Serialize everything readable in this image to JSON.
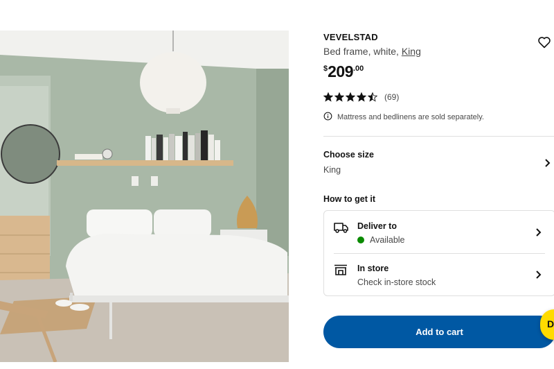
{
  "product": {
    "name": "VEVELSTAD",
    "description": "Bed frame, white, ",
    "size_link": "King",
    "price": {
      "currency": "$",
      "integer": "209",
      "decimal": ".00"
    },
    "rating": {
      "value": 4.5,
      "max": 5,
      "count_text": "(69)"
    },
    "note": "Mattress and bedlinens are sold separately."
  },
  "size": {
    "label": "Choose size",
    "value": "King"
  },
  "delivery": {
    "heading": "How to get it",
    "options": [
      {
        "title": "Deliver to",
        "subtitle": "Available",
        "icon": "truck-icon",
        "status_color": "#0a8a00"
      },
      {
        "title": "In store",
        "subtitle": "Check in-store stock",
        "icon": "store-icon"
      }
    ]
  },
  "cart": {
    "label": "Add to cart"
  },
  "chat": {
    "glyph": "D"
  },
  "colors": {
    "accent": "#0058a3",
    "chat": "#ffdb00",
    "available": "#0a8a00"
  },
  "icons": {
    "wishlist": "heart-icon",
    "info": "info-icon",
    "chevron": "chevron-right-icon"
  }
}
